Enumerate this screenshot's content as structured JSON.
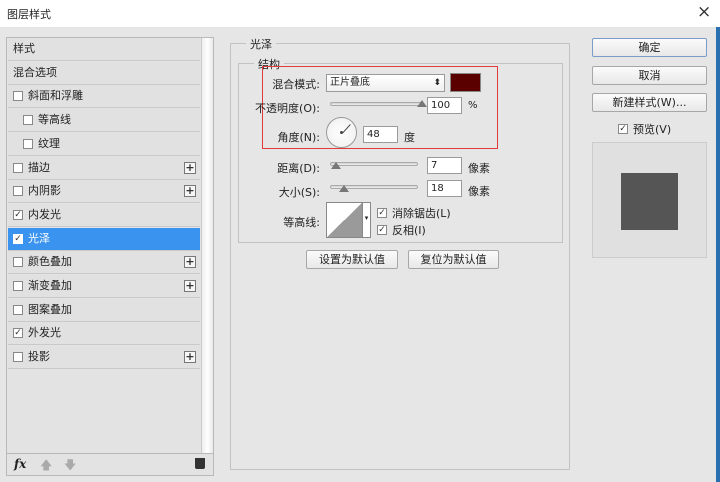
{
  "window": {
    "title": "图层样式",
    "close": "×"
  },
  "sidebar": {
    "items": [
      {
        "label": "样式",
        "checkbox": null,
        "plus": false
      },
      {
        "label": "混合选项",
        "checkbox": null,
        "plus": false
      },
      {
        "label": "斜面和浮雕",
        "checkbox": false,
        "plus": false
      },
      {
        "label": "等高线",
        "checkbox": false,
        "plus": false,
        "indent": true
      },
      {
        "label": "纹理",
        "checkbox": false,
        "plus": false,
        "indent": true
      },
      {
        "label": "描边",
        "checkbox": false,
        "plus": true
      },
      {
        "label": "内阴影",
        "checkbox": false,
        "plus": true
      },
      {
        "label": "内发光",
        "checkbox": true,
        "plus": false
      },
      {
        "label": "光泽",
        "checkbox": true,
        "plus": false,
        "selected": true
      },
      {
        "label": "颜色叠加",
        "checkbox": false,
        "plus": true
      },
      {
        "label": "渐变叠加",
        "checkbox": false,
        "plus": true
      },
      {
        "label": "图案叠加",
        "checkbox": false,
        "plus": false
      },
      {
        "label": "外发光",
        "checkbox": true,
        "plus": false
      },
      {
        "label": "投影",
        "checkbox": false,
        "plus": true
      }
    ],
    "toolbar": {
      "fx": "fx"
    }
  },
  "panel": {
    "title": "光泽",
    "section": "结构",
    "blend_mode": {
      "label": "混合模式:",
      "value": "正片叠底",
      "color": "#5a0000"
    },
    "opacity": {
      "label": "不透明度(O):",
      "value": "100",
      "unit": "%",
      "percent": 100
    },
    "angle": {
      "label": "角度(N):",
      "value": "48",
      "unit": "度",
      "degrees": 48
    },
    "distance": {
      "label": "距离(D):",
      "value": "7",
      "unit": "像素",
      "percent": 3
    },
    "size": {
      "label": "大小(S):",
      "value": "18",
      "unit": "像素",
      "percent": 13
    },
    "contour": {
      "label": "等高线:"
    },
    "anti_alias": {
      "label": "消除锯齿(L)",
      "checked": true
    },
    "invert": {
      "label": "反相(I)",
      "checked": true
    },
    "set_default": "设置为默认值",
    "reset_default": "复位为默认值"
  },
  "buttons": {
    "ok": "确定",
    "cancel": "取消",
    "new_style": "新建样式(W)...",
    "preview": "预览(V)",
    "preview_checked": true
  }
}
